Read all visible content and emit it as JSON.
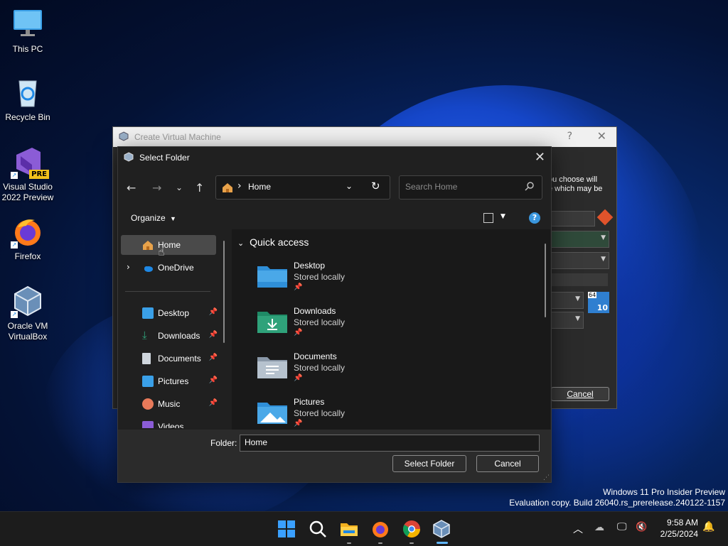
{
  "desktop": {
    "icons": [
      {
        "label": "This PC"
      },
      {
        "label": "Recycle Bin"
      },
      {
        "label": "Visual Studio 2022 Preview",
        "badge": "PRE"
      },
      {
        "label": "Firefox"
      },
      {
        "label": "Oracle VM VirtualBox"
      }
    ],
    "watermark": {
      "line1": "Windows 11 Pro Insider Preview",
      "line2": "Evaluation copy. Build 26040.rs_prerelease.240122-1157"
    }
  },
  "vbox_window": {
    "title": "Create Virtual Machine",
    "help": "?",
    "close": "✕",
    "side_text_1": "ou choose will",
    "side_text_2": "e which may be",
    "os_badge_top": "64",
    "os_badge_num": "10",
    "cancel_label": "Cancel"
  },
  "dialog": {
    "title": "Select Folder",
    "close": "✕",
    "address": "Home",
    "address_sep": "›",
    "search_placeholder": "Search Home",
    "organize_label": "Organize",
    "help_label": "?",
    "nav": {
      "home": "Home",
      "onedrive": "OneDrive",
      "pinned": [
        {
          "label": "Desktop"
        },
        {
          "label": "Downloads"
        },
        {
          "label": "Documents"
        },
        {
          "label": "Pictures"
        },
        {
          "label": "Music"
        },
        {
          "label": "Videos"
        }
      ]
    },
    "quick_access": {
      "header": "Quick access",
      "items": [
        {
          "name": "Desktop",
          "status": "Stored locally"
        },
        {
          "name": "Downloads",
          "status": "Stored locally"
        },
        {
          "name": "Documents",
          "status": "Stored locally"
        },
        {
          "name": "Pictures",
          "status": "Stored locally"
        }
      ]
    },
    "folder_label": "Folder:",
    "folder_value": "Home",
    "select_button": "Select Folder",
    "cancel_button": "Cancel"
  },
  "taskbar": {
    "time": "9:58 AM",
    "date": "2/25/2024"
  },
  "colors": {
    "accent": "#3a96dd",
    "warning": "#e0532b",
    "folder_blue": "#4aa8e8",
    "folder_green": "#2fa27a"
  }
}
